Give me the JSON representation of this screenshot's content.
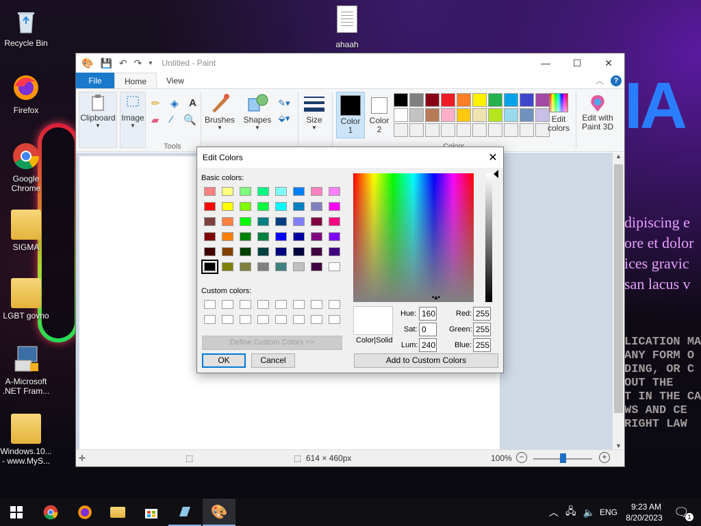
{
  "desktop": {
    "icons": [
      {
        "label": "Recycle Bin"
      },
      {
        "label": "Firefox"
      },
      {
        "label": "Google Chrome"
      },
      {
        "label": "SIGMA"
      },
      {
        "label": "LGBT govno"
      },
      {
        "label": "A-Microsoft .NET Fram..."
      },
      {
        "label": "Windows.10... - www.MyS..."
      },
      {
        "label": "ahaah"
      }
    ],
    "wallpaper": {
      "big_text": "IA",
      "lorem_lines": [
        "dipiscing e",
        "ore et dolor",
        "ices gravic",
        "san lacus v"
      ],
      "caps_lines": [
        "LICATION MA",
        "ANY FORM O",
        "DING, OR C",
        "OUT THE",
        "T IN THE CA",
        "WS AND CE",
        "RIGHT LAW"
      ]
    }
  },
  "paint": {
    "title": "Untitled - Paint",
    "tabs": {
      "file": "File",
      "home": "Home",
      "view": "View"
    },
    "ribbon": {
      "clipboard": "Clipboard",
      "image": "Image",
      "tools": "Tools",
      "brushes": "Brushes",
      "shapes": "Shapes",
      "size": "Size",
      "color1": "Color 1",
      "color2": "Color 2",
      "colors": "Colors",
      "edit_colors": "Edit colors",
      "edit_paint3d": "Edit with Paint 3D"
    },
    "palette_row1": [
      "#000000",
      "#7f7f7f",
      "#880015",
      "#ed1c24",
      "#ff7f27",
      "#fff200",
      "#22b14c",
      "#00a2e8",
      "#3f48cc",
      "#a349a4"
    ],
    "palette_row2": [
      "#ffffff",
      "#c3c3c3",
      "#b97a57",
      "#ffaec9",
      "#ffc90e",
      "#efe4b0",
      "#b5e61d",
      "#99d9ea",
      "#7092be",
      "#c8bfe7"
    ],
    "status": {
      "dimensions": "614 × 460px",
      "zoom": "100%"
    },
    "zoom_percent": 100
  },
  "dialog": {
    "title": "Edit Colors",
    "basic_label": "Basic colors:",
    "custom_label": "Custom colors:",
    "basic_colors": [
      "#ff8080",
      "#ffff80",
      "#80ff80",
      "#00ff80",
      "#80ffff",
      "#0080ff",
      "#ff80c0",
      "#ff80ff",
      "#ff0000",
      "#ffff00",
      "#80ff00",
      "#00ff40",
      "#00ffff",
      "#0080c0",
      "#8080c0",
      "#ff00ff",
      "#804040",
      "#ff8040",
      "#00ff00",
      "#008080",
      "#004080",
      "#8080ff",
      "#800040",
      "#ff0080",
      "#800000",
      "#ff8000",
      "#008000",
      "#008040",
      "#0000ff",
      "#0000a0",
      "#800080",
      "#8000ff",
      "#400000",
      "#804000",
      "#004000",
      "#004040",
      "#000080",
      "#000040",
      "#400040",
      "#400080",
      "#000000",
      "#808000",
      "#808040",
      "#808080",
      "#408080",
      "#c0c0c0",
      "#400040",
      "#ffffff"
    ],
    "selected_index": 40,
    "define_custom": "Define Custom Colors >>",
    "ok": "OK",
    "cancel": "Cancel",
    "color_solid": "Color|Solid",
    "hue_label": "Hue:",
    "hue": "160",
    "sat_label": "Sat:",
    "sat": "0",
    "lum_label": "Lum:",
    "lum": "240",
    "red_label": "Red:",
    "red": "255",
    "green_label": "Green:",
    "green": "255",
    "blue_label": "Blue:",
    "blue": "255",
    "add_custom": "Add to Custom Colors"
  },
  "taskbar": {
    "lang": "ENG",
    "time": "9:23 AM",
    "date": "8/20/2023",
    "notifications": "1"
  }
}
